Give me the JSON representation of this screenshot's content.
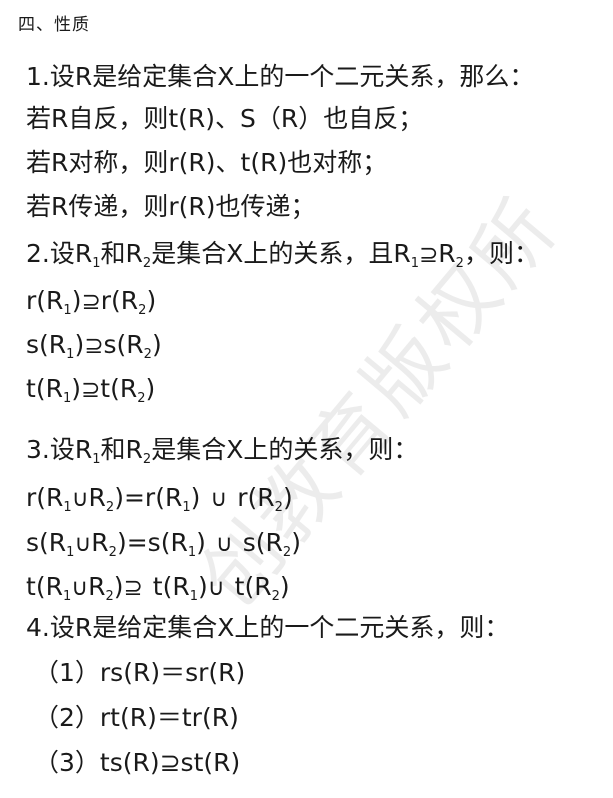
{
  "heading": "四、性质",
  "watermark_text": "创教育版权所",
  "item1": {
    "intro": "1.设R是给定集合X上的一个二元关系，那么：",
    "reflexive": "若R自反，则t(R)、S（R）也自反；",
    "symmetric": "若R对称，则r(R)、t(R)也对称；",
    "transitive": "若R传递，则r(R)也传递；"
  },
  "item2": {
    "num_label": "2.",
    "set_word": "设",
    "R": "R",
    "i1": "1",
    "i2": "2",
    "and_word": "和",
    "middle_text": "是集合X上的关系，且",
    "superset": "⊇",
    "end_text": "，则：",
    "closures": [
      "r",
      "s",
      "t"
    ]
  },
  "item3": {
    "num_label": "3.",
    "intro_rest": "是集合X上的关系，则：",
    "union": "∪",
    "eq": "=",
    "superset": "⊇",
    "closures": [
      "r",
      "s",
      "t"
    ]
  },
  "item4": {
    "intro": "4.设R是给定集合X上的一个二元关系，则：",
    "rules": [
      "（1）rs(R)＝sr(R)",
      "（2）rt(R)＝tr(R)",
      "（3）ts(R)⊇st(R)"
    ]
  }
}
